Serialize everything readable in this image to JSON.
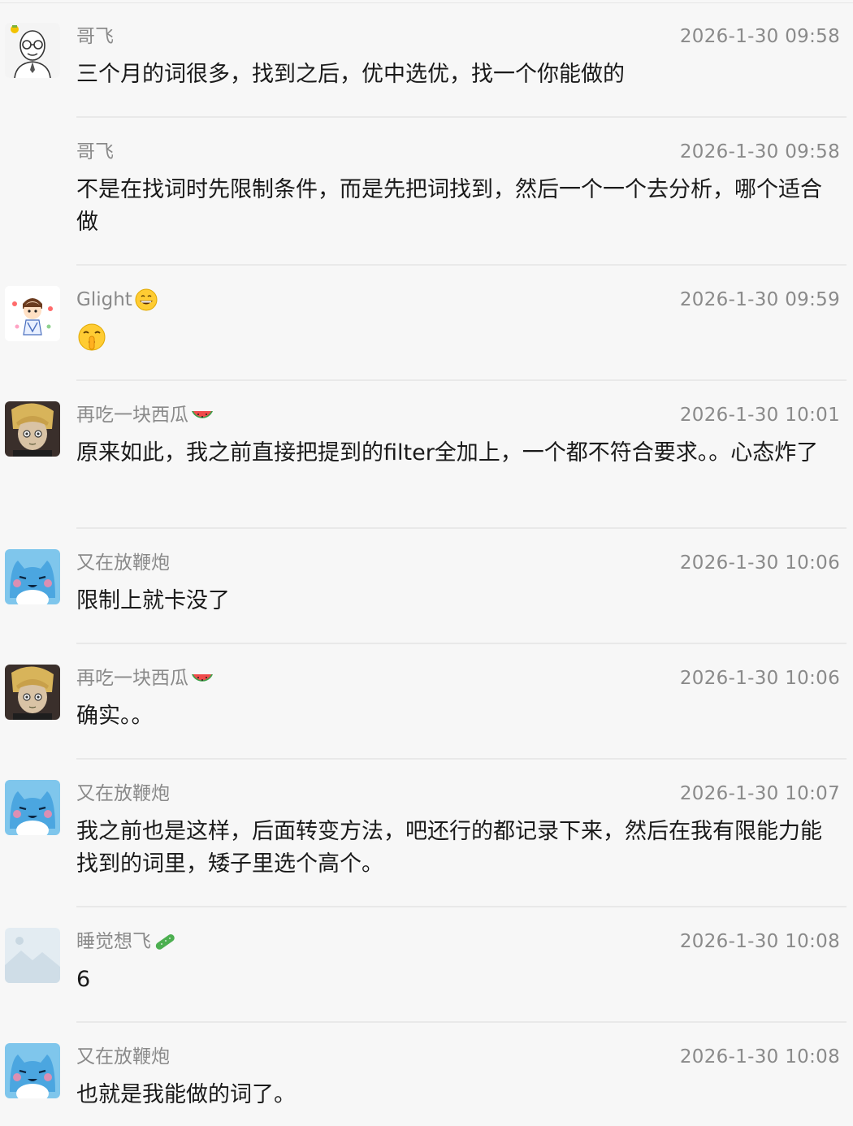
{
  "messages": [
    {
      "name": "哥飞",
      "time": "2026-1-30 09:58",
      "text": "三个月的词很多，找到之后，优中选优，找一个你能做的",
      "avatar": "bald-man-glasses-avatar"
    },
    {
      "name": "哥飞",
      "time": "2026-1-30 09:58",
      "text": "不是在找词时先限制条件，而是先把词找到，然后一个一个去分析，哪个适合做"
    },
    {
      "name": "Glight",
      "name_emoji": "grinning-emoji",
      "time": "2026-1-30 09:59",
      "sticker": "shushing-face-emoji",
      "avatar": "cartoon-boy-avatar"
    },
    {
      "name": "再吃一块西瓜",
      "name_emoji": "watermelon-emoji",
      "time": "2026-1-30 10:01",
      "text": "原来如此，我之前直接把提到的filter全加上，一个都不符合要求。。心态炸了",
      "avatar": "anime-boy-avatar"
    },
    {
      "name": "又在放鞭炮",
      "time": "2026-1-30 10:06",
      "text": "限制上就卡没了",
      "avatar": "blue-cat-avatar"
    },
    {
      "name": "再吃一块西瓜",
      "name_emoji": "watermelon-emoji",
      "time": "2026-1-30 10:06",
      "text": "确实。。",
      "avatar": "anime-boy-avatar"
    },
    {
      "name": "又在放鞭炮",
      "time": "2026-1-30 10:07",
      "text": "我之前也是这样，后面转变方法，吧还行的都记录下来，然后在我有限能力能找到的词里，矮子里选个高个。",
      "avatar": "blue-cat-avatar"
    },
    {
      "name": "睡觉想飞",
      "name_emoji": "cucumber-emoji",
      "time": "2026-1-30 10:08",
      "text": "6",
      "avatar": "landscape-placeholder-avatar"
    },
    {
      "name": "又在放鞭炮",
      "time": "2026-1-30 10:08",
      "text": "也就是我能做的词了。",
      "avatar": "blue-cat-avatar"
    }
  ]
}
